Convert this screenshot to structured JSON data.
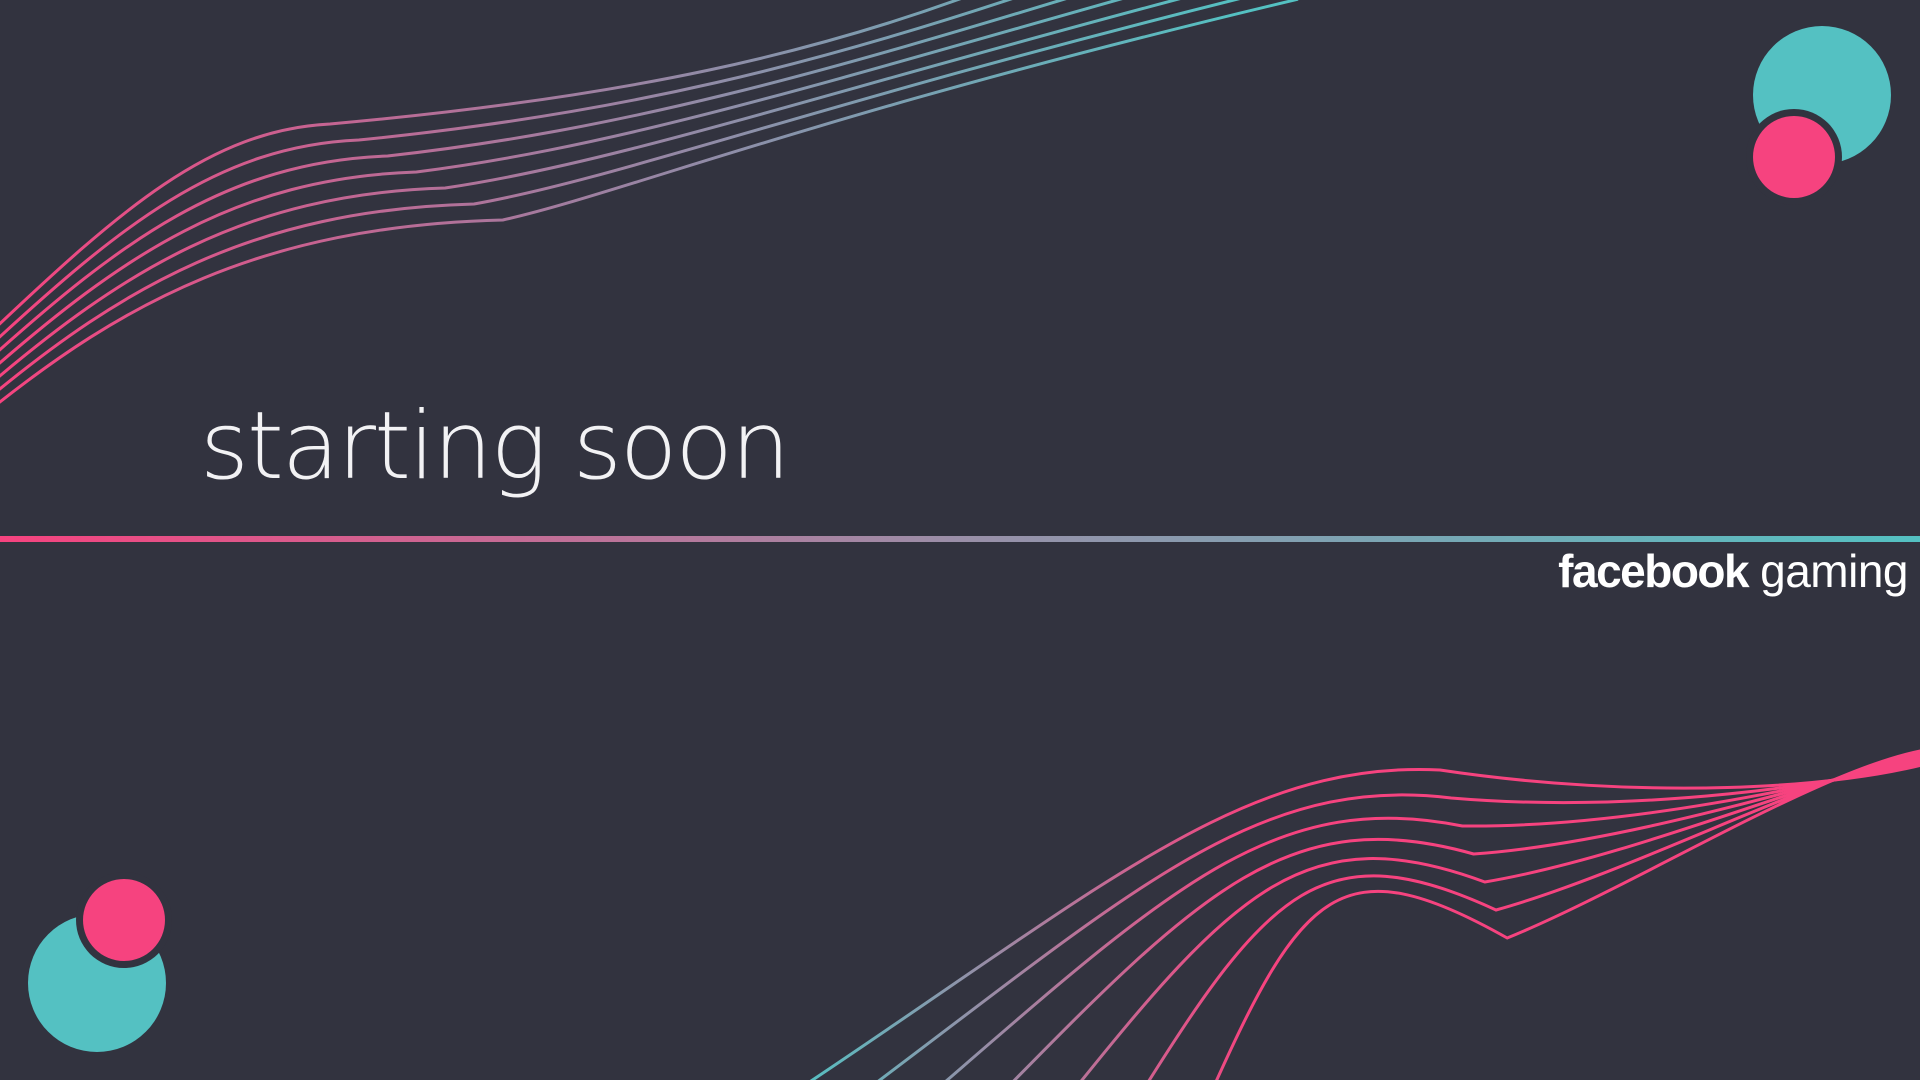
{
  "scene": {
    "title": "starting soon",
    "brand": {
      "bold": "facebook",
      "light": "gaming"
    }
  },
  "colors": {
    "background": "#32333f",
    "pink": "#f6437f",
    "teal": "#54c1c2",
    "text": "#f2f2f4"
  },
  "icons": [
    "circles-top-right",
    "circles-bottom-left",
    "wave-lines-top-left",
    "wave-lines-bottom-right",
    "gradient-divider"
  ]
}
